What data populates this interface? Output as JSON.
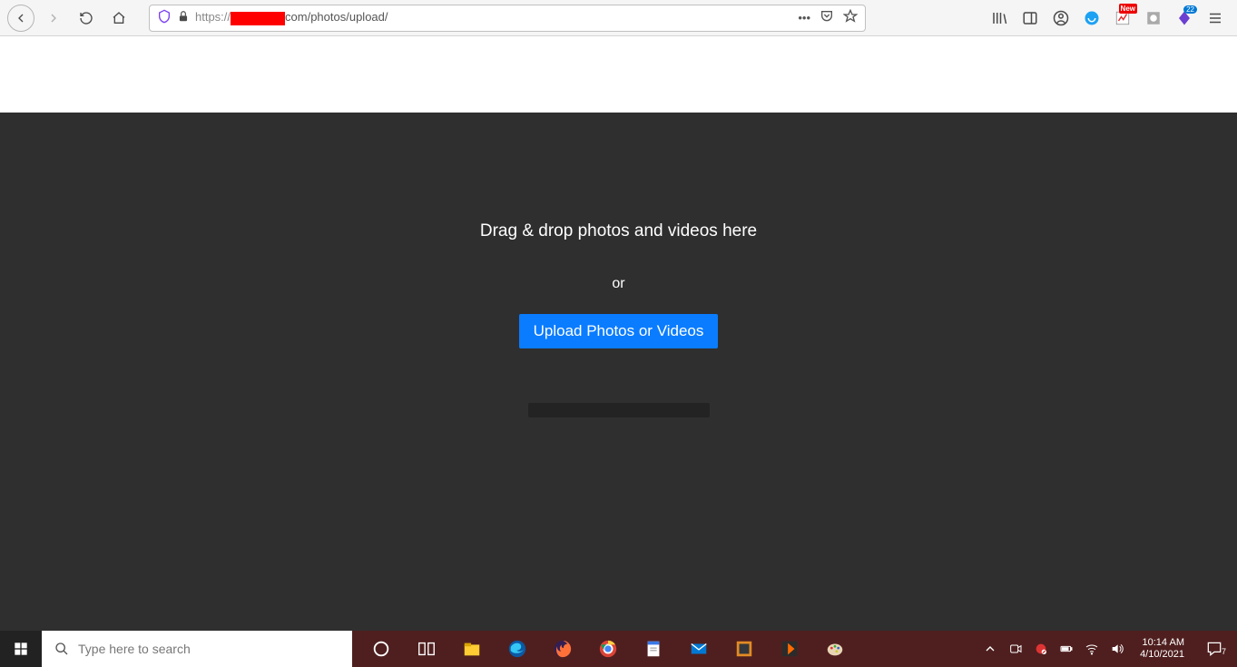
{
  "browser": {
    "url_prefix": "https://",
    "url_suffix": "com/photos/upload/",
    "tracking_shield": "shield-icon",
    "lock": "lock-icon"
  },
  "toolbar": {
    "ext_badge_new": "New",
    "ext_badge_count": "22"
  },
  "upload": {
    "main_text": "Drag & drop photos and videos here",
    "or_text": "or",
    "button_label": "Upload Photos or Videos"
  },
  "taskbar": {
    "search_placeholder": "Type here to search",
    "time": "10:14 AM",
    "date": "4/10/2021",
    "notif_count": "7"
  }
}
